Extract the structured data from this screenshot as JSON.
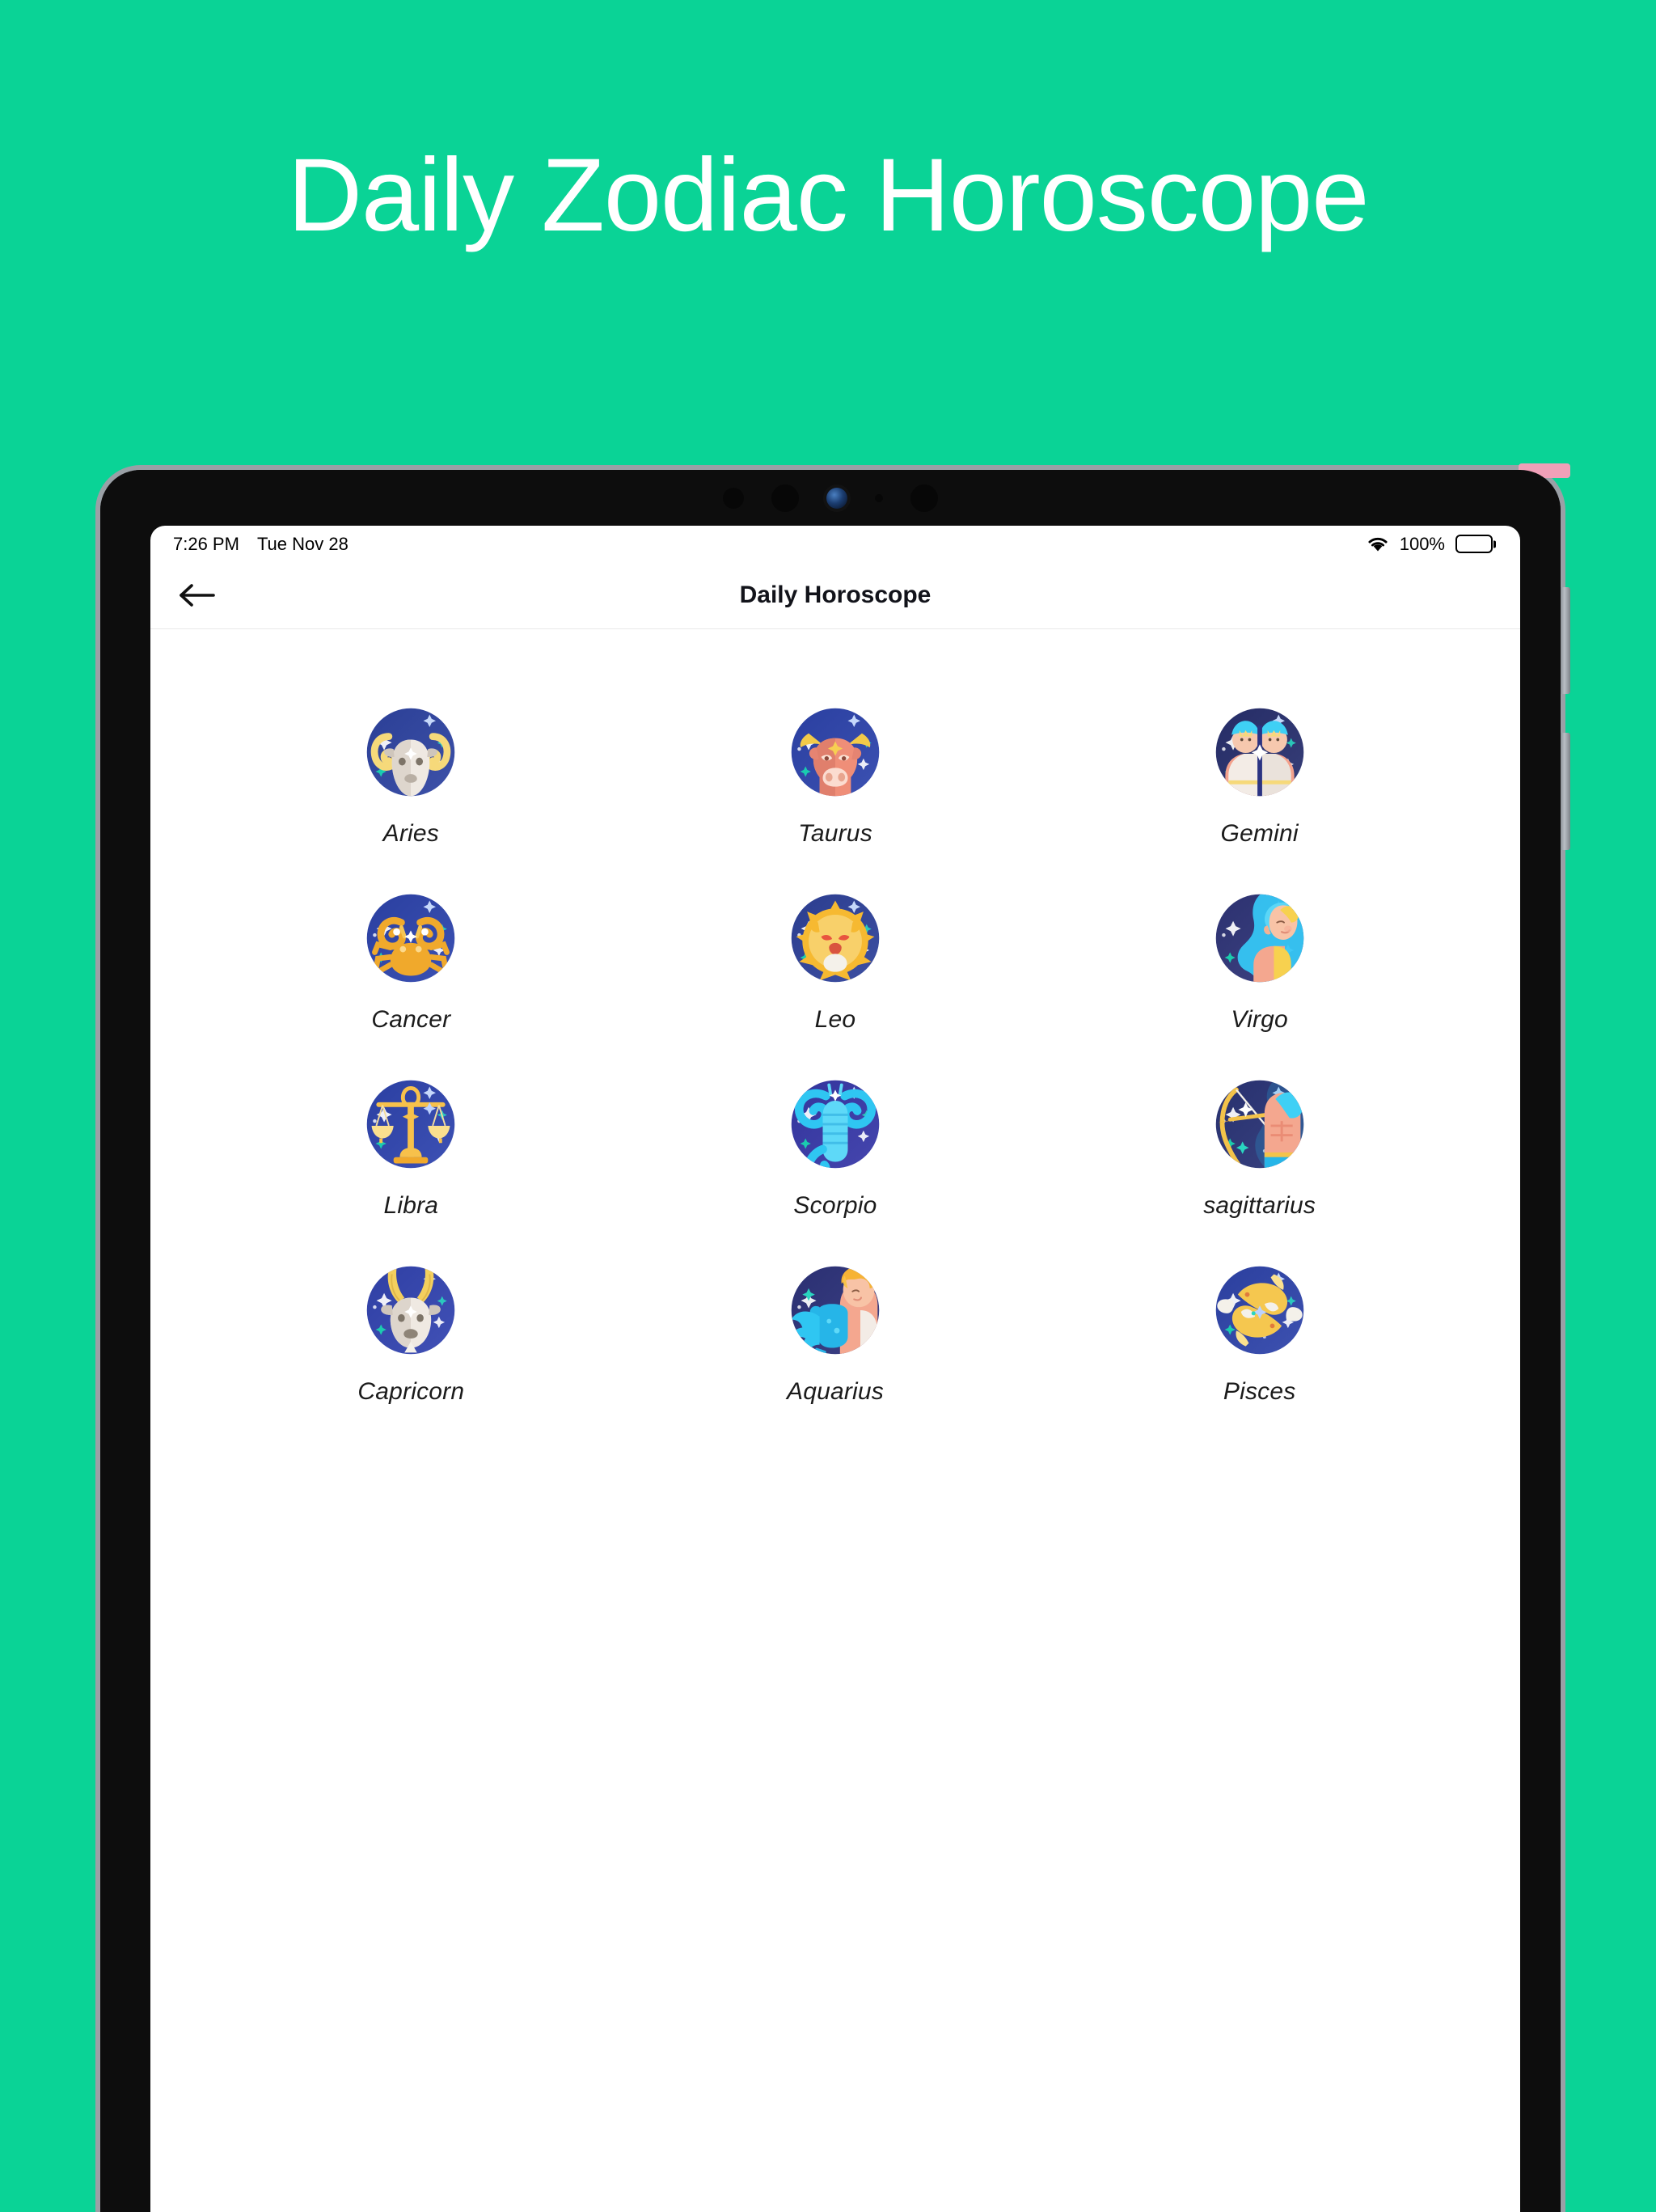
{
  "promo": {
    "title": "Daily Zodiac Horoscope",
    "background_color": "#0ad396",
    "title_color": "#ffffff"
  },
  "device": {
    "type": "tablet",
    "frame_color": "#9aa0a6",
    "body_color": "#141414",
    "accent_color": "#f0a0b8",
    "buttons": [
      {
        "name": "volume-up"
      },
      {
        "name": "volume-down"
      }
    ]
  },
  "status_bar": {
    "time": "7:26 PM",
    "date": "Tue Nov 28",
    "wifi_icon": "wifi-icon",
    "battery_percent": "100%",
    "battery_icon": "battery-full-icon",
    "battery_level": 100
  },
  "app_bar": {
    "back_icon": "arrow-left-icon",
    "title": "Daily Horoscope"
  },
  "zodiac": {
    "columns": 3,
    "signs": [
      {
        "id": "aries",
        "label": "Aries",
        "icon": "aries-ram-icon",
        "bg": "#2b3f96",
        "accent": "#f5d06a"
      },
      {
        "id": "taurus",
        "label": "Taurus",
        "icon": "taurus-bull-icon",
        "bg": "#2a3fa0",
        "accent": "#f2ca49"
      },
      {
        "id": "gemini",
        "label": "Gemini",
        "icon": "gemini-twins-icon",
        "bg": "#252c66",
        "accent": "#3fd0f5"
      },
      {
        "id": "cancer",
        "label": "Cancer",
        "icon": "cancer-crab-icon",
        "bg": "#2a3fa0",
        "accent": "#f0a92c"
      },
      {
        "id": "leo",
        "label": "Leo",
        "icon": "leo-lion-icon",
        "bg": "#2b3d8f",
        "accent": "#f6b931"
      },
      {
        "id": "virgo",
        "label": "Virgo",
        "icon": "virgo-maiden-icon",
        "bg": "#2c3170",
        "accent": "#36c6f4"
      },
      {
        "id": "libra",
        "label": "Libra",
        "icon": "libra-scales-icon",
        "bg": "#2b3fa2",
        "accent": "#f7c14b"
      },
      {
        "id": "scorpio",
        "label": "Scorpio",
        "icon": "scorpio-scorpion-icon",
        "bg": "#33349c",
        "accent": "#2fc6f2"
      },
      {
        "id": "sagittarius",
        "label": "sagittarius",
        "icon": "sagittarius-archer-icon",
        "bg": "#27306e",
        "accent": "#f3c34a"
      },
      {
        "id": "capricorn",
        "label": "Capricorn",
        "icon": "capricorn-goat-icon",
        "bg": "#2f3fa4",
        "accent": "#f3cf5e"
      },
      {
        "id": "aquarius",
        "label": "Aquarius",
        "icon": "aquarius-waterbearer-icon",
        "bg": "#2a2f72",
        "accent": "#25b5ef"
      },
      {
        "id": "pisces",
        "label": "Pisces",
        "icon": "pisces-fish-icon",
        "bg": "#2b3f9e",
        "accent": "#f5c74f"
      }
    ]
  }
}
